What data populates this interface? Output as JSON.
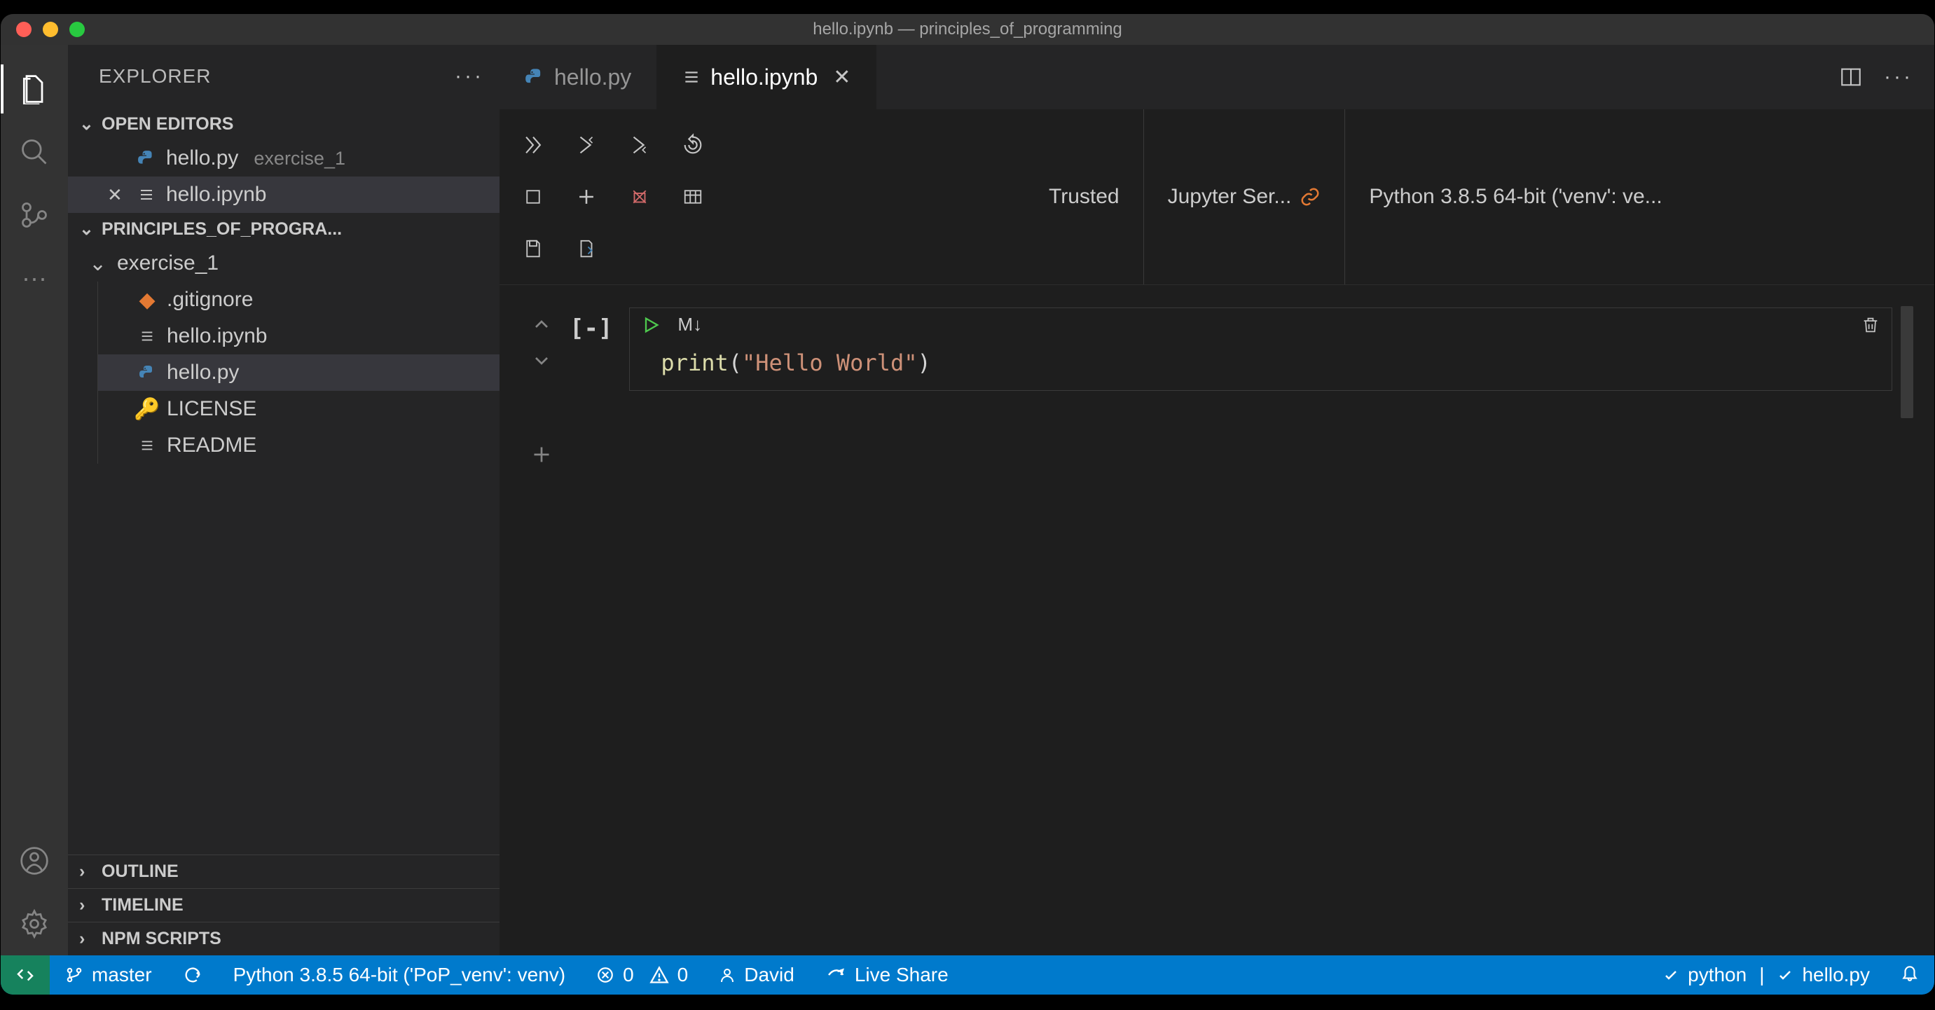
{
  "titlebar": {
    "title": "hello.ipynb — principles_of_programming"
  },
  "sidebar": {
    "title": "EXPLORER",
    "open_editors_label": "OPEN EDITORS",
    "project_label": "PRINCIPLES_OF_PROGRA...",
    "outline_label": "OUTLINE",
    "timeline_label": "TIMELINE",
    "npm_label": "NPM SCRIPTS",
    "open_editors": [
      {
        "name": "hello.py",
        "sub": "exercise_1",
        "icon": "python"
      },
      {
        "name": "hello.ipynb",
        "sub": "",
        "icon": "notebook",
        "close": true
      }
    ],
    "folder": "exercise_1",
    "files": [
      {
        "name": ".gitignore",
        "icon": "git"
      },
      {
        "name": "hello.ipynb",
        "icon": "notebook"
      },
      {
        "name": "hello.py",
        "icon": "python",
        "selected": true
      },
      {
        "name": "LICENSE",
        "icon": "key"
      },
      {
        "name": "README",
        "icon": "notebook"
      }
    ]
  },
  "tabs": [
    {
      "name": "hello.py",
      "icon": "python",
      "active": false
    },
    {
      "name": "hello.ipynb",
      "icon": "notebook",
      "active": true
    }
  ],
  "toolbar": {
    "trusted": "Trusted",
    "server": "Jupyter Ser...",
    "kernel": "Python 3.8.5 64-bit ('venv': ve..."
  },
  "cell": {
    "collapse": "[-]",
    "markdown": "M↓",
    "code_fn": "print",
    "code_open": "(",
    "code_str": "\"Hello World\"",
    "code_close": ")"
  },
  "status": {
    "branch": "master",
    "interpreter": "Python 3.8.5 64-bit ('PoP_venv': venv)",
    "errors": "0",
    "warnings": "0",
    "user": "David",
    "liveshare": "Live Share",
    "lang": "python",
    "file": "hello.py"
  }
}
